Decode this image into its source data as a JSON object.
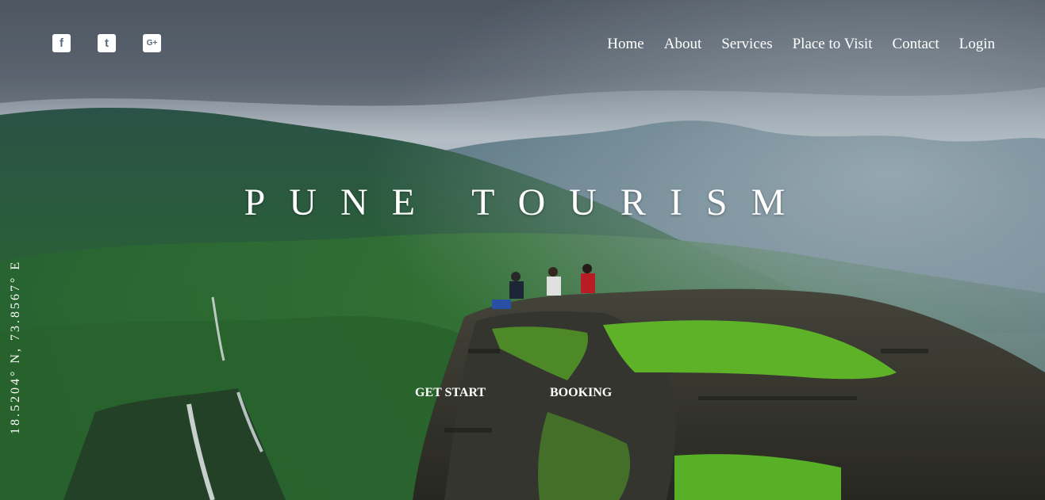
{
  "social": [
    {
      "name": "facebook",
      "icon": "facebook-icon",
      "glyph": "f"
    },
    {
      "name": "twitter",
      "icon": "twitter-icon",
      "glyph": "t"
    },
    {
      "name": "google-plus",
      "icon": "google-plus-icon",
      "glyph": "G+"
    }
  ],
  "nav": {
    "home": "Home",
    "about": "About",
    "services": "Services",
    "place": "Place to Visit",
    "contact": "Contact",
    "login": "Login"
  },
  "hero": {
    "title": "PUNE TOURISM",
    "coordinates": "18.5204° N, 73.8567° E",
    "get_start": "GET START",
    "booking": "BOOKING"
  }
}
